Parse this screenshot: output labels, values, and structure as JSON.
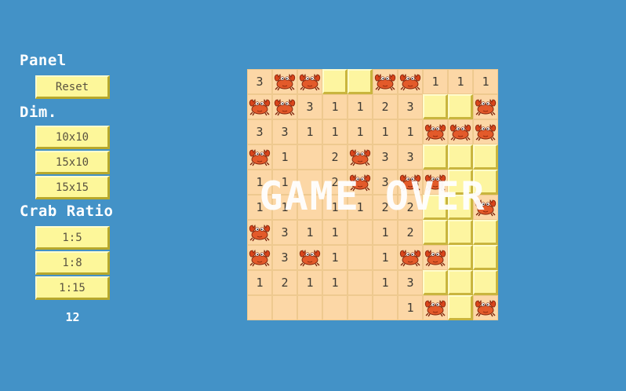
{
  "panel": {
    "title": "Panel",
    "reset_label": "Reset",
    "dim_label": "Dim.",
    "dims": [
      "10x10",
      "15x10",
      "15x15"
    ],
    "ratio_label": "Crab Ratio",
    "ratios": [
      "1:5",
      "1:8",
      "1:15"
    ],
    "count": "12"
  },
  "game": {
    "status": "GAME OVER",
    "rows": [
      [
        "3",
        "C",
        "C",
        "H",
        "H",
        "C",
        "C",
        "1",
        "1",
        "1"
      ],
      [
        "C",
        "C",
        "3",
        "1",
        "1",
        "2",
        "3",
        "H",
        "H",
        "C"
      ],
      [
        "3",
        "3",
        "1",
        "1",
        "1",
        "1",
        "1",
        "C",
        "C",
        "C"
      ],
      [
        "C",
        "1",
        "",
        "2",
        "C",
        "3",
        "3",
        "H",
        "H",
        "H"
      ],
      [
        "1",
        "1",
        "",
        "2",
        "C",
        "3",
        "C",
        "C",
        "H",
        "H"
      ],
      [
        "1",
        "1",
        "",
        "1",
        "1",
        "2",
        "2",
        "H",
        "H",
        "C"
      ],
      [
        "C",
        "3",
        "1",
        "1",
        "",
        "1",
        "2",
        "H",
        "H",
        "H"
      ],
      [
        "C",
        "3",
        "C",
        "1",
        "",
        "1",
        "C",
        "C",
        "H",
        "H"
      ],
      [
        "1",
        "2",
        "1",
        "1",
        "",
        "1",
        "3",
        "H",
        "H",
        "H"
      ],
      [
        "",
        "",
        "",
        "",
        "",
        "",
        "1",
        "C",
        "H",
        "C"
      ]
    ]
  },
  "colors": {
    "background": "#4392c7",
    "revealed": "#fcd7a6",
    "hidden": "#fdf5a0",
    "crab": "#d9451b"
  },
  "icons": {
    "crab": "crab-icon"
  }
}
